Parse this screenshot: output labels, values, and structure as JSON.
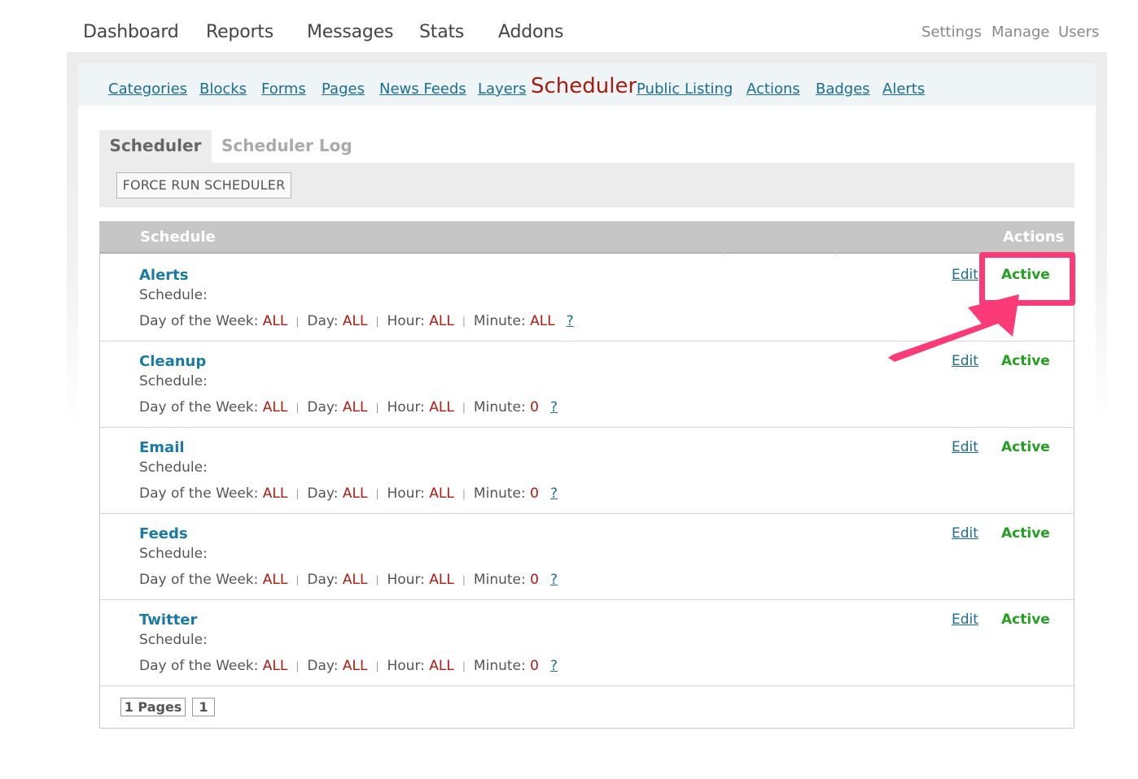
{
  "top_nav": {
    "main": [
      "Dashboard",
      "Reports",
      "Messages",
      "Stats",
      "Addons"
    ],
    "utility": [
      "Settings",
      "Manage",
      "Users"
    ]
  },
  "sub_nav": {
    "links_before": [
      "Categories",
      "Blocks",
      "Forms",
      "Pages",
      "News Feeds",
      "Layers"
    ],
    "current": "Scheduler",
    "links_after": [
      "Public Listing",
      "Actions",
      "Badges",
      "Alerts"
    ]
  },
  "tabs": {
    "active": "Scheduler",
    "inactive": "Scheduler Log"
  },
  "force_button": "FORCE RUN SCHEDULER",
  "table": {
    "col_schedule": "Schedule",
    "col_actions": "Actions",
    "labels": {
      "schedule": "Schedule:",
      "day_of_week": "Day of the Week:",
      "day": "Day:",
      "hour": "Hour:",
      "minute": "Minute:",
      "help": "?",
      "edit": "Edit"
    },
    "rows": [
      {
        "name": "Alerts",
        "day_of_week": "ALL",
        "day": "ALL",
        "hour": "ALL",
        "minute": "ALL",
        "status": "Active"
      },
      {
        "name": "Cleanup",
        "day_of_week": "ALL",
        "day": "ALL",
        "hour": "ALL",
        "minute": "0",
        "status": "Active"
      },
      {
        "name": "Email",
        "day_of_week": "ALL",
        "day": "ALL",
        "hour": "ALL",
        "minute": "0",
        "status": "Active"
      },
      {
        "name": "Feeds",
        "day_of_week": "ALL",
        "day": "ALL",
        "hour": "ALL",
        "minute": "0",
        "status": "Active"
      },
      {
        "name": "Twitter",
        "day_of_week": "ALL",
        "day": "ALL",
        "hour": "ALL",
        "minute": "0",
        "status": "Active"
      }
    ]
  },
  "pagination": {
    "pages_label": "1 Pages",
    "current_page": "1"
  },
  "colors": {
    "link": "#1a6e95",
    "current_nav": "#a51c10",
    "value": "#b01a10",
    "status_active": "#23a020",
    "annotation": "#fb3b77"
  }
}
